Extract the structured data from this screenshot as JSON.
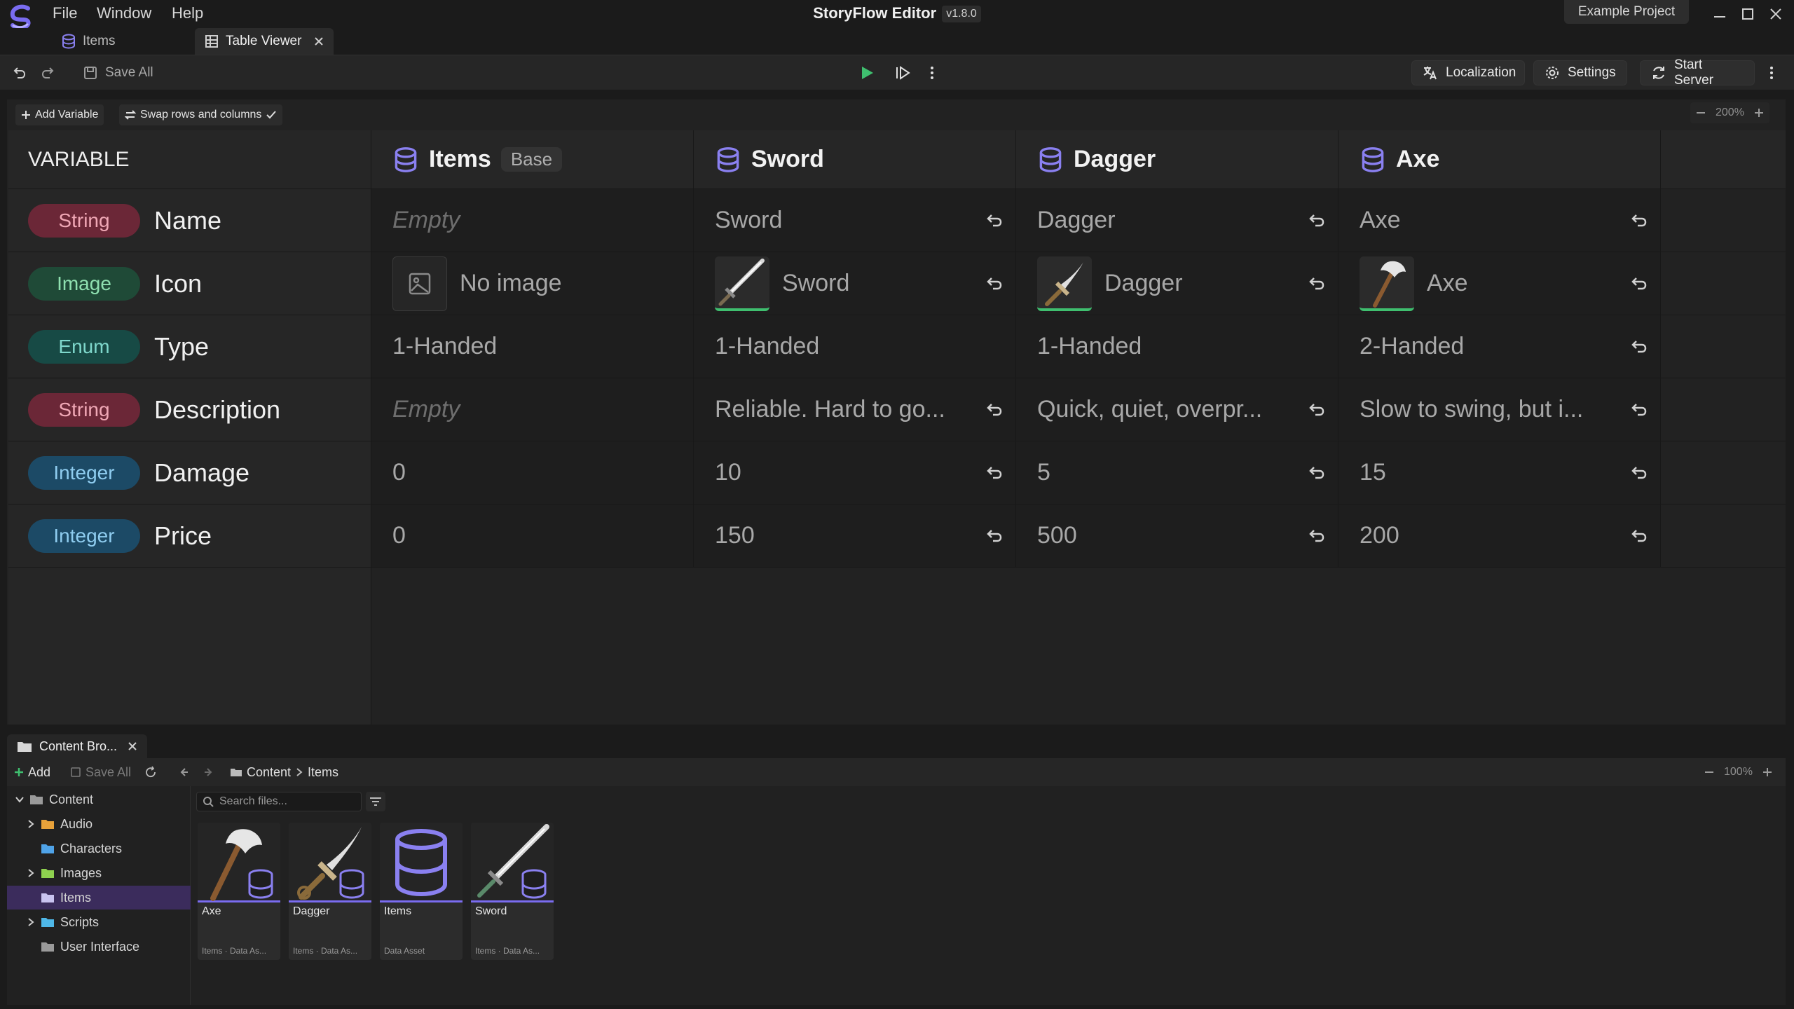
{
  "app": {
    "title": "StoryFlow Editor",
    "version": "v1.8.0",
    "project": "Example Project",
    "menu": [
      "File",
      "Window",
      "Help"
    ]
  },
  "tabs": [
    {
      "label": "Items",
      "icon": "database-icon",
      "active": false
    },
    {
      "label": "Table Viewer",
      "icon": "table-icon",
      "active": true
    }
  ],
  "toolbar": {
    "save_all": "Save All",
    "localization": "Localization",
    "settings": "Settings",
    "start_server": "Start Server"
  },
  "table": {
    "add_variable": "Add Variable",
    "swap_label": "Swap rows and columns",
    "zoom": "200%",
    "variable_header": "VARIABLE",
    "columns": [
      {
        "name": "Items",
        "badge": "Base"
      },
      {
        "name": "Sword"
      },
      {
        "name": "Dagger"
      },
      {
        "name": "Axe"
      }
    ],
    "rows": [
      {
        "type": "String",
        "name": "Name",
        "values": [
          "Empty",
          "Sword",
          "Dagger",
          "Axe"
        ]
      },
      {
        "type": "Image",
        "name": "Icon",
        "values": [
          "No image",
          "Sword",
          "Dagger",
          "Axe"
        ]
      },
      {
        "type": "Enum",
        "name": "Type",
        "values": [
          "1-Handed",
          "1-Handed",
          "1-Handed",
          "2-Handed"
        ]
      },
      {
        "type": "String",
        "name": "Description",
        "values": [
          "Empty",
          "Reliable. Hard to go...",
          "Quick, quiet, overpr...",
          "Slow to swing, but i..."
        ]
      },
      {
        "type": "Integer",
        "name": "Damage",
        "values": [
          "0",
          "10",
          "5",
          "15"
        ]
      },
      {
        "type": "Integer",
        "name": "Price",
        "values": [
          "0",
          "150",
          "500",
          "200"
        ]
      }
    ]
  },
  "content_browser": {
    "tab": "Content Bro...",
    "add": "Add",
    "save_all": "Save All",
    "breadcrumb": [
      "Content",
      "Items"
    ],
    "zoom": "100%",
    "search_placeholder": "Search files...",
    "tree": [
      {
        "label": "Content",
        "expanded": true,
        "color": "#9a9a9a"
      },
      {
        "label": "Audio",
        "color": "#e8a23a"
      },
      {
        "label": "Characters",
        "color": "#4fa3e8"
      },
      {
        "label": "Images",
        "color": "#8fd14f"
      },
      {
        "label": "Items",
        "color": "#c9c3f0",
        "selected": true
      },
      {
        "label": "Scripts",
        "color": "#4fb8e8"
      },
      {
        "label": "User Interface",
        "color": "#9a9a9a"
      }
    ],
    "assets": [
      {
        "name": "Axe",
        "type": "Items · Data As..."
      },
      {
        "name": "Dagger",
        "type": "Items · Data As..."
      },
      {
        "name": "Items",
        "type": "Data Asset"
      },
      {
        "name": "Sword",
        "type": "Items · Data As..."
      }
    ]
  },
  "colors": {
    "accent": "#7a6cf0",
    "play": "#3fbf6f",
    "string": "#6b2737",
    "image": "#1f4a37",
    "enum": "#174a45",
    "integer": "#1c4a66"
  }
}
